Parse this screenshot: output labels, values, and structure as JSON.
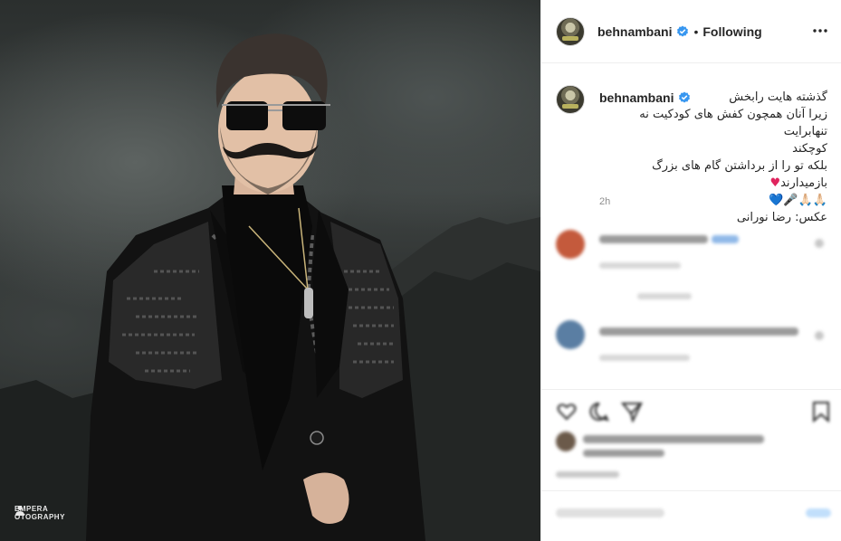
{
  "photo": {
    "watermark_line1": "EMPERA",
    "watermark_line2": "OTOGRAPHY"
  },
  "header": {
    "username": "behnambani",
    "separator": "•",
    "follow_status": "Following"
  },
  "caption": {
    "username": "behnambani",
    "line1": "گذشته هایت رابخش",
    "line2": "زیرا آنان همچون کفش های کودکیت نه تنهابرایت",
    "line3": "کوچکند",
    "line4": "بلکه تو را از برداشتن گام های بزرگ بازمیدارند",
    "line4_heart": "♥",
    "line5": "🙏🏻🙏🏻🎤💙",
    "line6": "عکس: رضا نورانی",
    "time": "2h"
  },
  "colors": {
    "verified_blue": "#3897f0",
    "heart_red": "#e0245e",
    "border": "#efefef",
    "muted_text": "#8e8e8e"
  },
  "icons": {
    "more": "more-horizontal-icon",
    "verified": "verified-badge-icon",
    "like": "heart-icon",
    "comment": "comment-icon",
    "share": "send-icon",
    "save": "bookmark-icon"
  }
}
